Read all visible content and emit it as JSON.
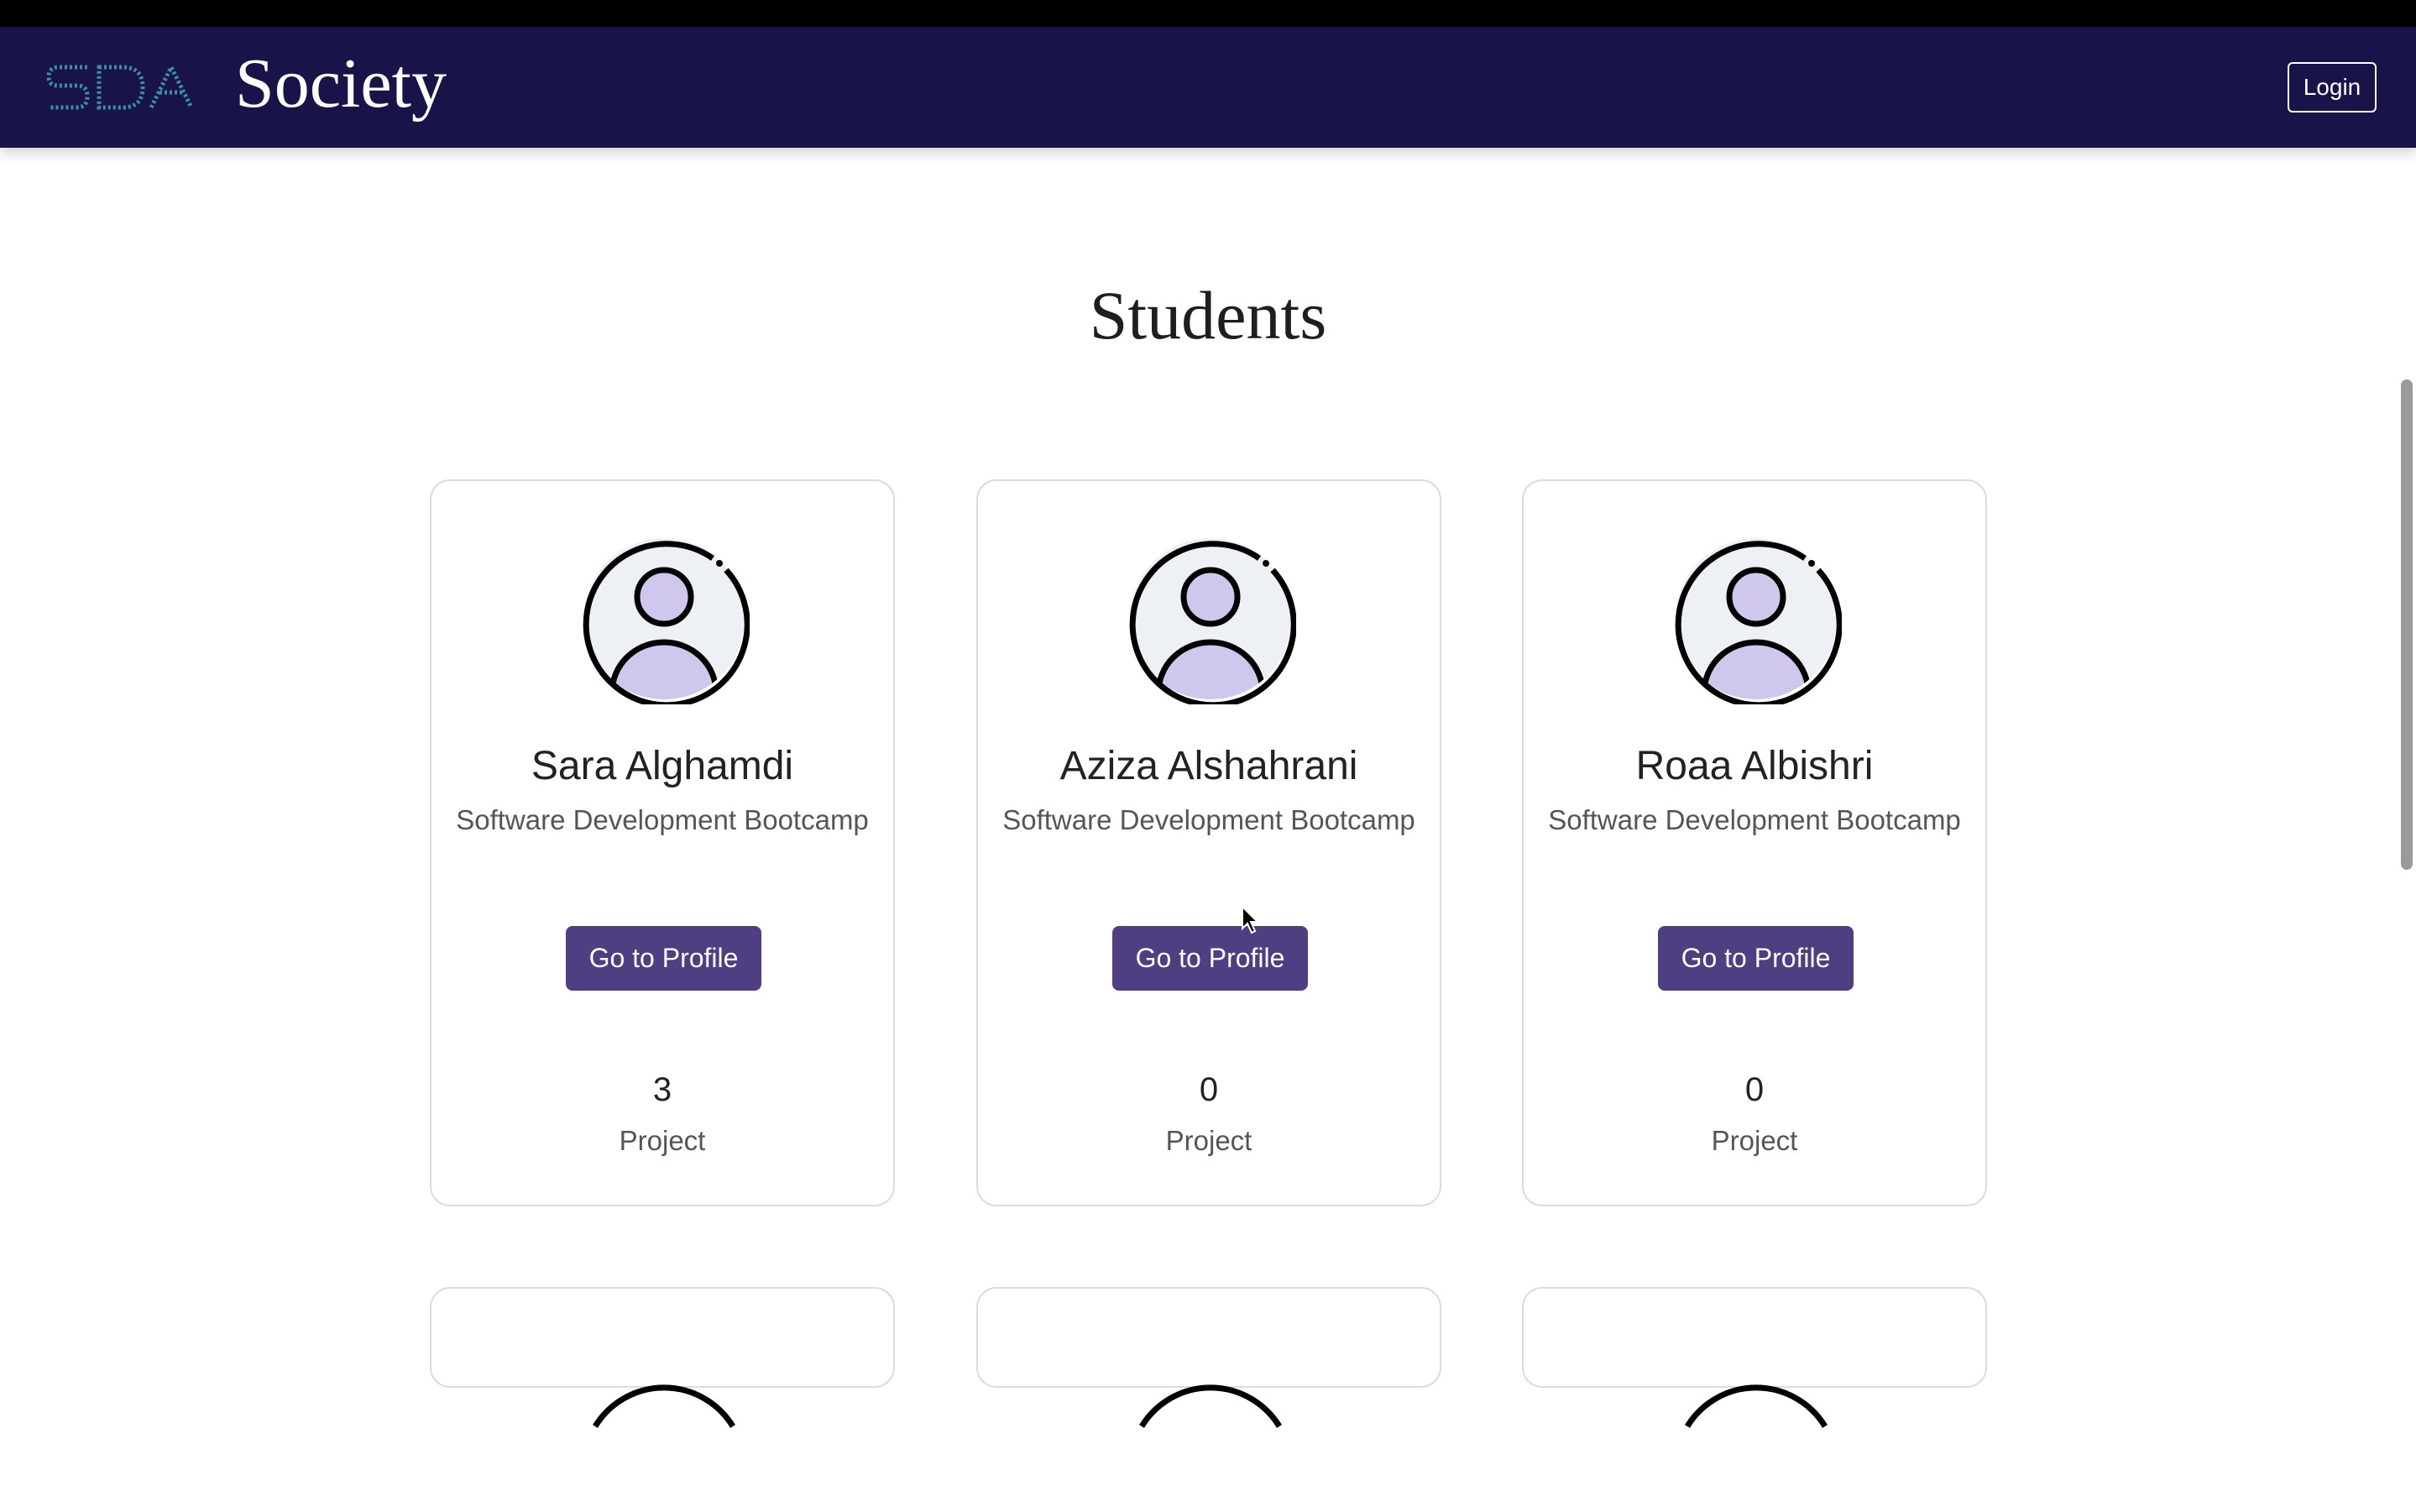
{
  "navbar": {
    "brand_name": "Society",
    "logo_text": "SDA",
    "login_label": "Login",
    "background_color": "#18144a"
  },
  "page": {
    "title": "Students"
  },
  "students": [
    {
      "name": "Sara Alghamdi",
      "program": "Software Development Bootcamp",
      "button_label": "Go to Profile",
      "project_count": "3",
      "project_label": "Project"
    },
    {
      "name": "Aziza Alshahrani",
      "program": "Software Development Bootcamp",
      "button_label": "Go to Profile",
      "project_count": "0",
      "project_label": "Project"
    },
    {
      "name": "Roaa Albishri",
      "program": "Software Development Bootcamp",
      "button_label": "Go to Profile",
      "project_count": "0",
      "project_label": "Project"
    }
  ],
  "colors": {
    "accent_button": "#4f3e82",
    "avatar_fill": "#cfc8ec",
    "avatar_bg": "#edf0f4"
  },
  "icons": {
    "avatar": "user-avatar-icon",
    "logo": "sda-logo-icon",
    "cursor": "mouse-pointer-icon"
  }
}
